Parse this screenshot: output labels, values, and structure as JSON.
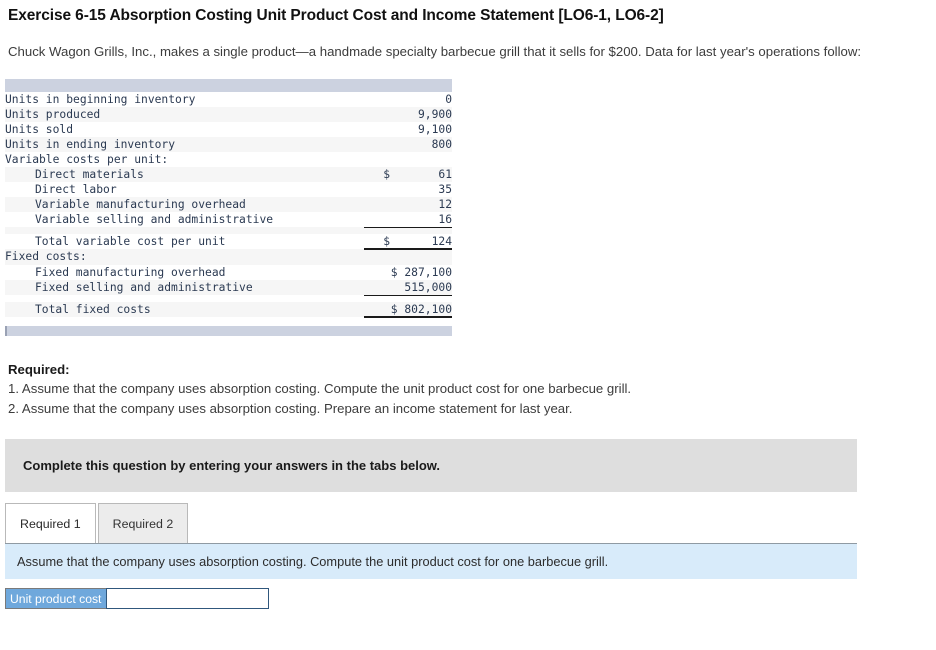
{
  "exercise": {
    "title": "Exercise 6-15 Absorption Costing Unit Product Cost and Income Statement [LO6-1, LO6-2]",
    "intro": "Chuck Wagon Grills, Inc., makes a single product—a handmade specialty barbecue grill that it sells for $200. Data for last year's operations follow:"
  },
  "data_table": {
    "rows": [
      {
        "label": "Units in beginning inventory",
        "indent": 0,
        "currency": "",
        "value": "0"
      },
      {
        "label": "Units produced",
        "indent": 0,
        "currency": "",
        "value": "9,900"
      },
      {
        "label": "Units sold",
        "indent": 0,
        "currency": "",
        "value": "9,100"
      },
      {
        "label": "Units in ending inventory",
        "indent": 0,
        "currency": "",
        "value": "800"
      },
      {
        "label": "Variable costs per unit:",
        "indent": 0,
        "currency": "",
        "value": ""
      },
      {
        "label": "Direct materials",
        "indent": 1,
        "currency": "$",
        "value": "61"
      },
      {
        "label": "Direct labor",
        "indent": 1,
        "currency": "",
        "value": "35"
      },
      {
        "label": "Variable manufacturing overhead",
        "indent": 1,
        "currency": "",
        "value": "12"
      },
      {
        "label": "Variable selling and administrative",
        "indent": 1,
        "currency": "",
        "value": "16"
      },
      {
        "label": "Total variable cost per unit",
        "indent": 1,
        "currency": "$",
        "value": "124"
      },
      {
        "label": "Fixed costs:",
        "indent": 0,
        "currency": "",
        "value": ""
      },
      {
        "label": "Fixed manufacturing overhead",
        "indent": 1,
        "currency": "",
        "value": "$ 287,100"
      },
      {
        "label": "Fixed selling and administrative",
        "indent": 1,
        "currency": "",
        "value": "515,000"
      },
      {
        "label": "Total fixed costs",
        "indent": 1,
        "currency": "",
        "value": "$ 802,100"
      }
    ]
  },
  "required": {
    "heading": "Required:",
    "items": [
      "1. Assume that the company uses absorption costing. Compute the unit product cost for one barbecue grill.",
      "2. Assume that the company uses absorption costing. Prepare an income statement for last year."
    ]
  },
  "complete_banner": {
    "text": "Complete this question by entering your answers in the tabs below."
  },
  "tabs": [
    {
      "label": "Required 1",
      "active": true
    },
    {
      "label": "Required 2",
      "active": false
    }
  ],
  "tab_panel": {
    "instruction": "Assume that the company uses absorption costing. Compute the unit product cost for one barbecue grill.",
    "answer_label": "Unit product cost",
    "answer_value": "",
    "answer_placeholder": ""
  },
  "colors": {
    "table_header_bar": "#ccd2e0",
    "banner_grey": "#dedede",
    "strip_blue": "#d8ebfa",
    "answer_label_blue": "#6fa8dc",
    "input_border": "#30577c"
  }
}
